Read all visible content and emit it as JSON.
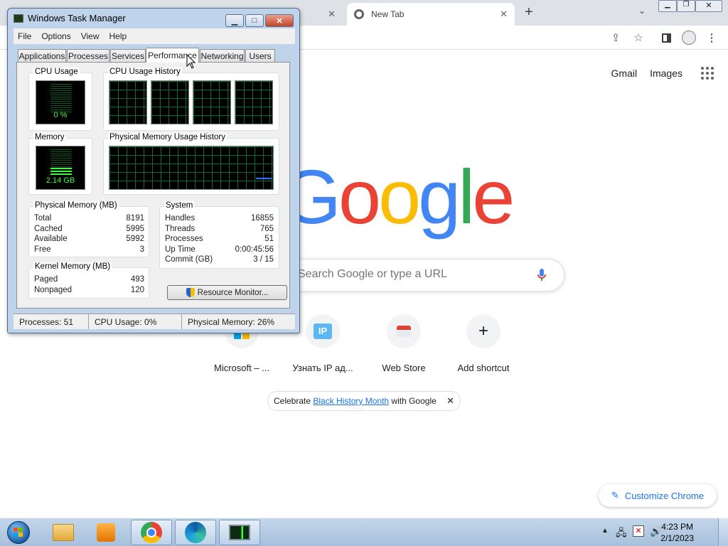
{
  "chrome": {
    "tab_title": "New Tab",
    "header_links": [
      "Gmail",
      "Images"
    ],
    "search_placeholder": "Search Google or type a URL",
    "shortcuts": [
      {
        "label": "Microsoft – ..."
      },
      {
        "label": "Узнать IP ад..."
      },
      {
        "label": "Web Store"
      },
      {
        "label": "Add shortcut"
      }
    ],
    "promo": {
      "prefix": "Celebrate ",
      "link": "Black History Month",
      "suffix": " with Google"
    },
    "customize_label": "Customize Chrome",
    "logo_letters": [
      "G",
      "o",
      "o",
      "g",
      "l",
      "e"
    ],
    "logo_colors": [
      "#4285f4",
      "#ea4335",
      "#fbbc05",
      "#4285f4",
      "#34a853",
      "#ea4335"
    ]
  },
  "taskmgr": {
    "title": "Windows Task Manager",
    "menu": [
      "File",
      "Options",
      "View",
      "Help"
    ],
    "tabs": [
      "Applications",
      "Processes",
      "Services",
      "Performance",
      "Networking",
      "Users"
    ],
    "selected_tab": "Performance",
    "cpu_usage_title": "CPU Usage",
    "cpu_usage_value": "0 %",
    "cpu_history_title": "CPU Usage History",
    "memory_title": "Memory",
    "memory_value": "2.14 GB",
    "phys_history_title": "Physical Memory Usage History",
    "physical_memory": {
      "title": "Physical Memory (MB)",
      "rows": [
        {
          "label": "Total",
          "value": "8191"
        },
        {
          "label": "Cached",
          "value": "5995"
        },
        {
          "label": "Available",
          "value": "5992"
        },
        {
          "label": "Free",
          "value": "3"
        }
      ]
    },
    "kernel_memory": {
      "title": "Kernel Memory (MB)",
      "rows": [
        {
          "label": "Paged",
          "value": "493"
        },
        {
          "label": "Nonpaged",
          "value": "120"
        }
      ]
    },
    "system": {
      "title": "System",
      "rows": [
        {
          "label": "Handles",
          "value": "16855"
        },
        {
          "label": "Threads",
          "value": "765"
        },
        {
          "label": "Processes",
          "value": "51"
        },
        {
          "label": "Up Time",
          "value": "0:00:45:56"
        },
        {
          "label": "Commit (GB)",
          "value": "3 / 15"
        }
      ]
    },
    "resource_monitor_label": "Resource Monitor...",
    "status": {
      "processes": "Processes: 51",
      "cpu": "CPU Usage: 0%",
      "memory": "Physical Memory: 26%"
    }
  },
  "taskbar": {
    "time": "4:23 PM",
    "date": "2/1/2023"
  }
}
